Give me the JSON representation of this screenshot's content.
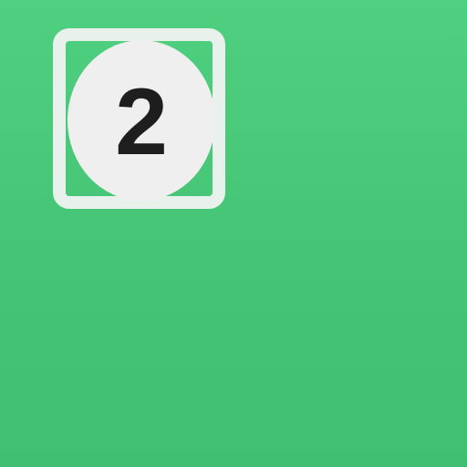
{
  "badge": {
    "number": "2"
  },
  "colors": {
    "background": "#46c777",
    "frame": "#e8f1ec",
    "circle": "#efefef",
    "number": "#1e1e1e"
  }
}
